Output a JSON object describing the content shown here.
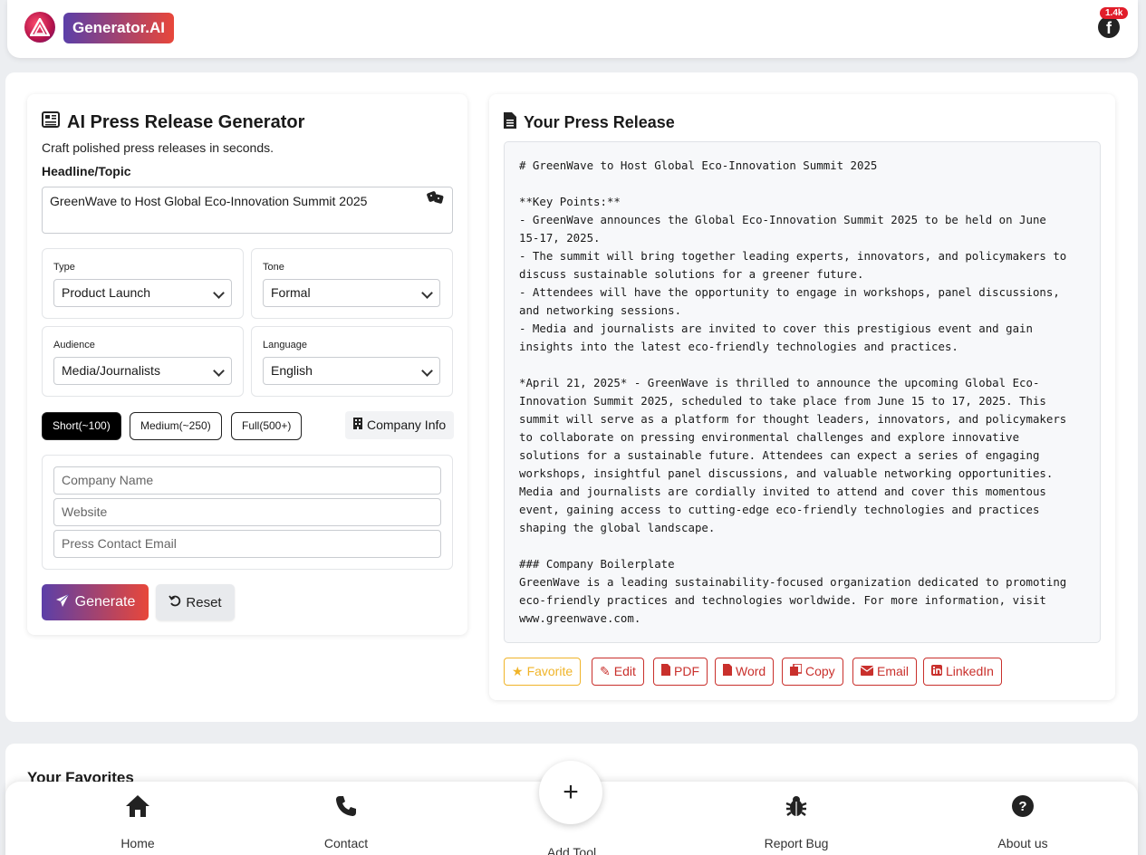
{
  "header": {
    "brand": "Generator.AI",
    "facebook_count": "1.4k"
  },
  "generator": {
    "title": "AI Press Release Generator",
    "subtitle": "Craft polished press releases in seconds.",
    "headline_label": "Headline/Topic",
    "headline_value": "GreenWave to Host Global Eco-Innovation Summit 2025",
    "type": {
      "label": "Type",
      "value": "Product Launch"
    },
    "tone": {
      "label": "Tone",
      "value": "Formal"
    },
    "audience": {
      "label": "Audience",
      "value": "Media/Journalists"
    },
    "language": {
      "label": "Language",
      "value": "English"
    },
    "length_options": [
      "Short(~100)",
      "Medium(~250)",
      "Full(500+)"
    ],
    "active_length": "Short(~100)",
    "company_info_label": "Company Info",
    "company_name_placeholder": "Company Name",
    "website_placeholder": "Website",
    "email_placeholder": "Press Contact Email",
    "generate_label": "Generate",
    "reset_label": "Reset"
  },
  "output": {
    "title": "Your Press Release",
    "lines": [
      "# GreenWave to Host Global Eco-Innovation Summit 2025",
      "",
      "**Key Points:**",
      "- GreenWave announces the Global Eco-Innovation Summit 2025 to be held on June",
      "15-17, 2025.",
      "- The summit will bring together leading experts, innovators, and policymakers to",
      "discuss sustainable solutions for a greener future.",
      "- Attendees will have the opportunity to engage in workshops, panel discussions,",
      "and networking sessions.",
      "- Media and journalists are invited to cover this prestigious event and gain",
      "insights into the latest eco-friendly technologies and practices.",
      "",
      "*April 21, 2025* - GreenWave is thrilled to announce the upcoming Global Eco-",
      "Innovation Summit 2025, scheduled to take place from June 15 to 17, 2025. This",
      "summit will serve as a platform for thought leaders, innovators, and policymakers",
      "to collaborate on pressing environmental challenges and explore innovative",
      "solutions for a sustainable future. Attendees can expect a series of engaging",
      "workshops, insightful panel discussions, and valuable networking opportunities.",
      "Media and journalists are cordially invited to attend and cover this momentous",
      "event, gaining access to cutting-edge eco-friendly technologies and practices",
      "shaping the global landscape.",
      "",
      "### Company Boilerplate",
      "GreenWave is a leading sustainability-focused organization dedicated to promoting",
      "eco-friendly practices and technologies worldwide. For more information, visit",
      "www.greenwave.com."
    ],
    "actions": {
      "favorite": "Favorite",
      "edit": "Edit",
      "pdf": "PDF",
      "word": "Word",
      "copy": "Copy",
      "email": "Email",
      "linkedin": "LinkedIn"
    }
  },
  "favorites": {
    "title": "Your Favorites"
  },
  "nav": {
    "home": "Home",
    "contact": "Contact",
    "add_tool": "Add Tool",
    "report_bug": "Report Bug",
    "about": "About us"
  }
}
